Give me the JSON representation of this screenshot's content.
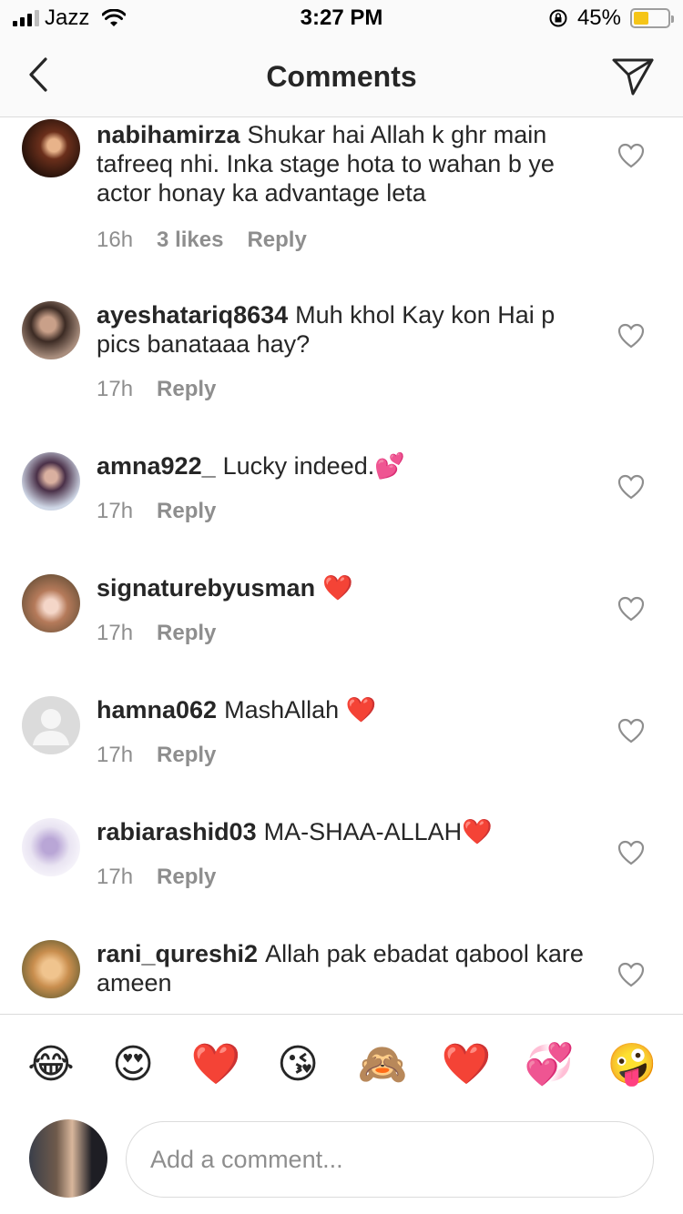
{
  "status_bar": {
    "carrier": "Jazz",
    "time": "3:27 PM",
    "battery_percent": "45%",
    "battery_level": 0.45,
    "signal_bars_on": 3,
    "signal_bars_total": 4
  },
  "header": {
    "title": "Comments",
    "back_icon": "chevron-left-icon",
    "share_icon": "paper-plane-icon"
  },
  "comments": [
    {
      "username": "nabihamirza",
      "text": "Shukar hai Allah k ghr main tafreeq nhi. Inka stage hota to wahan b ye actor honay ka advantage leta",
      "time": "16h",
      "likes": "3 likes",
      "reply": "Reply",
      "emoji": ""
    },
    {
      "username": "ayeshatariq8634",
      "text": "Muh khol Kay kon Hai p pics banataaa hay?",
      "time": "17h",
      "likes": "",
      "reply": "Reply",
      "emoji": ""
    },
    {
      "username": "amna922_",
      "text": "Lucky indeed.",
      "time": "17h",
      "likes": "",
      "reply": "Reply",
      "emoji": "💕"
    },
    {
      "username": "signaturebyusman",
      "text": "",
      "time": "17h",
      "likes": "",
      "reply": "Reply",
      "emoji": "❤️"
    },
    {
      "username": "hamna062",
      "text": "MashAllah",
      "time": "17h",
      "likes": "",
      "reply": "Reply",
      "emoji": "❤️"
    },
    {
      "username": "rabiarashid03",
      "text": "MA-SHAA-ALLAH",
      "time": "17h",
      "likes": "",
      "reply": "Reply",
      "emoji": "❤️"
    },
    {
      "username": "rani_qureshi2",
      "text": "Allah pak ebadat qabool kare ameen",
      "time": "",
      "likes": "",
      "reply": "",
      "emoji": ""
    }
  ],
  "emoji_bar": [
    "😂",
    "😍",
    "❤️",
    "😘",
    "🙈",
    "❤️",
    "💞",
    "🤪"
  ],
  "composer": {
    "placeholder": "Add a comment..."
  },
  "colors": {
    "text": "#262626",
    "secondary": "#8e8e8e",
    "divider": "#dbdbdb",
    "bar_bg": "#fafafa",
    "battery": "#f5c518"
  }
}
